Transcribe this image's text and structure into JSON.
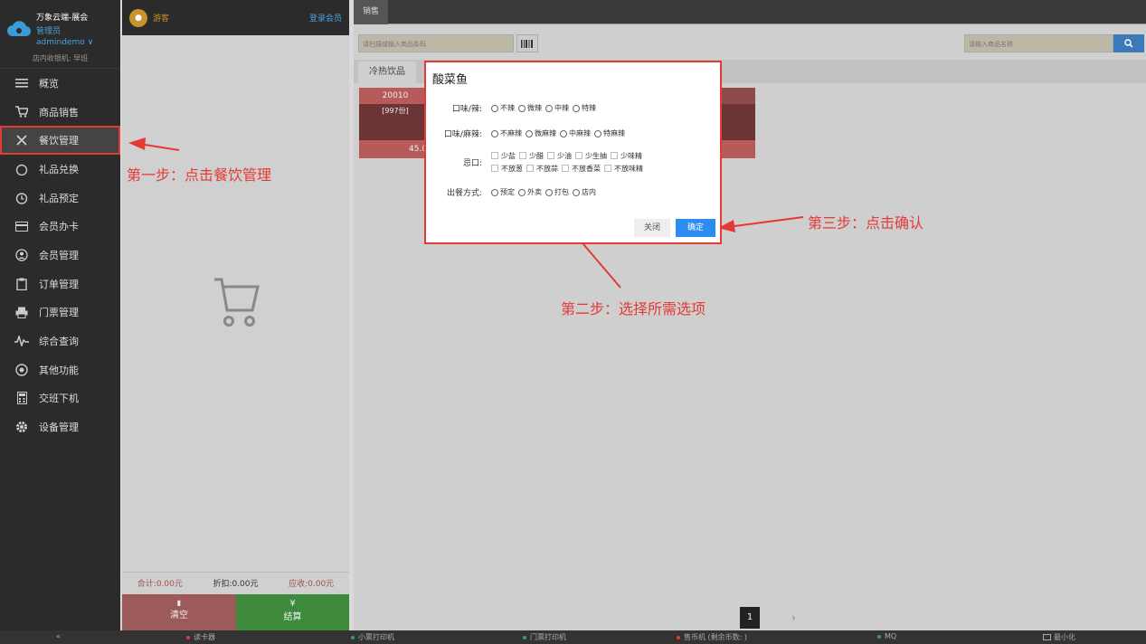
{
  "brand": {
    "name": "万象云端-展会",
    "role": "管理员",
    "user": "admindemo ∨",
    "shift": "店内收银机: 早班"
  },
  "nav": [
    {
      "label": "概览",
      "icon": "menu-icon"
    },
    {
      "label": "商品销售",
      "icon": "cart-icon"
    },
    {
      "label": "餐饮管理",
      "icon": "utensils-icon"
    },
    {
      "label": "礼品兑换",
      "icon": "gift-icon"
    },
    {
      "label": "礼品预定",
      "icon": "alarm-icon"
    },
    {
      "label": "会员办卡",
      "icon": "card-icon"
    },
    {
      "label": "会员管理",
      "icon": "user-icon"
    },
    {
      "label": "订单管理",
      "icon": "clipboard-icon"
    },
    {
      "label": "门票管理",
      "icon": "printer-icon"
    },
    {
      "label": "综合查询",
      "icon": "pulse-icon"
    },
    {
      "label": "其他功能",
      "icon": "aperture-icon"
    },
    {
      "label": "交班下机",
      "icon": "calculator-icon"
    },
    {
      "label": "设备管理",
      "icon": "gear-icon"
    }
  ],
  "cart": {
    "guest": "游客",
    "login": "登录会员",
    "total": "合计:0.00元",
    "discount": "折扣:0.00元",
    "due": "应收:0.00元",
    "clear": "清空",
    "clear_glyph": "▮",
    "pay": "结算",
    "pay_glyph": "¥"
  },
  "main": {
    "tab": "销售",
    "scan_placeholder": "请扫描或输入商品条码",
    "name_placeholder": "请输入商品名称",
    "category": "冷热饮品",
    "product": {
      "code": "20010",
      "stock": "[997份]",
      "price": "45.0"
    },
    "page": "1",
    "next": "›"
  },
  "dialog": {
    "title": "酸菜鱼",
    "spicy": {
      "label": "口味/辣:",
      "options": [
        "不辣",
        "微辣",
        "中辣",
        "特辣"
      ]
    },
    "numb": {
      "label": "口味/麻辣:",
      "options": [
        "不麻辣",
        "微麻辣",
        "中麻辣",
        "特麻辣"
      ]
    },
    "avoid": {
      "label": "忌口:",
      "row1": [
        "少盐",
        "少醋",
        "少油",
        "少生抽",
        "少味精"
      ],
      "row2": [
        "不放葱",
        "不放蒜",
        "不放香菜",
        "不放味精"
      ]
    },
    "serve": {
      "label": "出餐方式:",
      "options": [
        "预定",
        "外卖",
        "打包",
        "店内"
      ]
    },
    "close": "关闭",
    "ok": "确定"
  },
  "annotations": {
    "step1": "第一步：点击餐饮管理",
    "step2": "第二步：选择所需选项",
    "step3": "第三步：点击确认"
  },
  "status": {
    "collapse": "«",
    "card_reader": "读卡器",
    "receipt_printer": "小票打印机",
    "ticket_printer": "门票打印机",
    "coin_machine": "售币机 (剩余币数: )",
    "mq": "MQ",
    "minimize": "最小化"
  },
  "colors": {
    "accent": "#e53935",
    "primary": "#2d8cf0",
    "sidebar": "#2b2b2b"
  }
}
